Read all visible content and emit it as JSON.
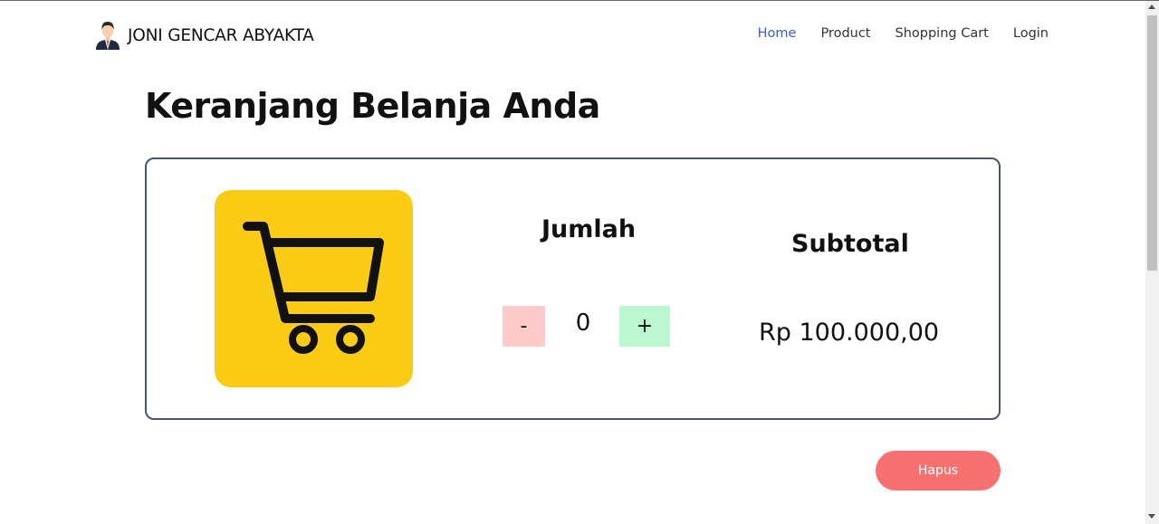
{
  "brand": {
    "name": "JONI GENCAR ABYAKTA",
    "avatar_icon": "person-avatar-icon"
  },
  "nav": {
    "items": [
      {
        "label": "Home",
        "active": true
      },
      {
        "label": "Product",
        "active": false
      },
      {
        "label": "Shopping Cart",
        "active": false
      },
      {
        "label": "Login",
        "active": false
      }
    ],
    "active_color": "#3b5bcc"
  },
  "page": {
    "title": "Keranjang Belanja Anda"
  },
  "cart_item": {
    "image_icon": "shopping-cart-icon",
    "image_bg": "#facc15",
    "quantity_label": "Jumlah",
    "quantity": "0",
    "decrement_label": "-",
    "increment_label": "+",
    "subtotal_label": "Subtotal",
    "subtotal_value": "Rp 100.000,00"
  },
  "actions": {
    "delete_label": "Hapus",
    "delete_color": "#f87171"
  },
  "colors": {
    "minus_bg": "#fecaca",
    "plus_bg": "#bbf7d0",
    "card_border": "#4a5568"
  }
}
